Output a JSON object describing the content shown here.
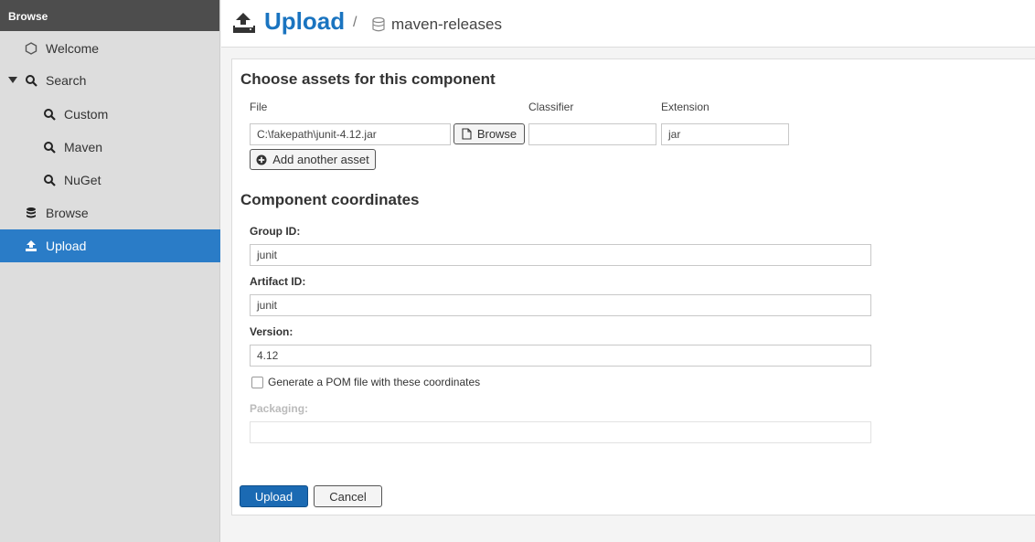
{
  "sidebar": {
    "header": "Browse",
    "items": [
      {
        "label": "Welcome",
        "icon": "hexagon-icon"
      },
      {
        "label": "Search",
        "icon": "search-icon"
      },
      {
        "label": "Custom",
        "icon": "search-icon"
      },
      {
        "label": "Maven",
        "icon": "search-icon"
      },
      {
        "label": "NuGet",
        "icon": "search-icon"
      },
      {
        "label": "Browse",
        "icon": "database-icon"
      },
      {
        "label": "Upload",
        "icon": "upload-icon",
        "active": true
      }
    ]
  },
  "header": {
    "title": "Upload",
    "separator": "/",
    "repository": "maven-releases"
  },
  "assets": {
    "title": "Choose assets for this component",
    "col_file": "File",
    "col_classifier": "Classifier",
    "col_extension": "Extension",
    "file_value": "C:\\fakepath\\junit-4.12.jar",
    "browse_label": "Browse",
    "classifier_value": "",
    "extension_value": "jar",
    "add_asset_label": "Add another asset"
  },
  "coordinates": {
    "title": "Component coordinates",
    "group_label": "Group ID:",
    "group_value": "junit",
    "artifact_label": "Artifact ID:",
    "artifact_value": "junit",
    "version_label": "Version:",
    "version_value": "4.12",
    "pom_label": "Generate a POM file with these coordinates",
    "pom_checked": false,
    "packaging_label": "Packaging:",
    "packaging_value": ""
  },
  "actions": {
    "upload_label": "Upload",
    "cancel_label": "Cancel"
  },
  "colors": {
    "accent": "#2a7cc7",
    "title_blue": "#1a74c0",
    "primary_button": "#1b6ab3",
    "sidebar_header": "#4d4d4d"
  }
}
